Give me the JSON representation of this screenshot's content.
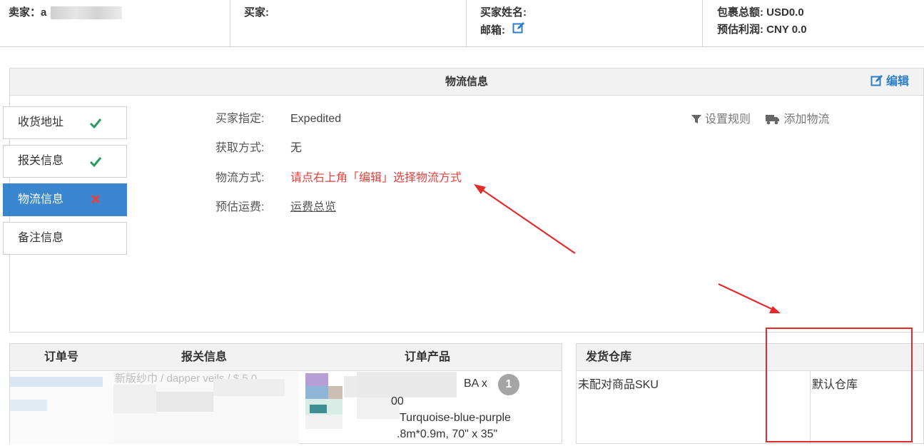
{
  "topbar": {
    "seller_label": "卖家：a",
    "buyer_label": "买家:",
    "buyer_name_label": "买家姓名:",
    "email_label": "邮箱:",
    "package_total": "包裹总额: USD0.0",
    "estimated_profit": "预估利润: CNY 0.0"
  },
  "logistics": {
    "title": "物流信息",
    "edit_label": "编辑",
    "tabs": [
      {
        "label": "收货地址",
        "status": "ok"
      },
      {
        "label": "报关信息",
        "status": "ok"
      },
      {
        "label": "物流信息",
        "status": "error"
      },
      {
        "label": "备注信息",
        "status": "none"
      }
    ],
    "rows": {
      "buyer_specified": {
        "label": "买家指定:",
        "value": "Expedited"
      },
      "acquire_method": {
        "label": "获取方式:",
        "value": "无"
      },
      "shipping_method": {
        "label": "物流方式:",
        "value": "请点右上角「编辑」选择物流方式"
      },
      "estimated_fee": {
        "label": "预估运费:",
        "value": "运费总览"
      }
    },
    "tools": {
      "set_rules": "设置规则",
      "add_logistics": "添加物流"
    }
  },
  "order_table": {
    "headers": {
      "order_no": "订单号",
      "customs": "报关信息",
      "product": "订单产品"
    },
    "customs_text": "新版纱巾 / dapper veils / $ 5.0",
    "product_line1": "BA x",
    "product_qty": "1",
    "product_line2": "00",
    "product_line3": "Turquoise-blue-purple",
    "product_line4": ".8m*0.9m, 70\" x 35\""
  },
  "warehouse_table": {
    "header": "发货仓库",
    "unmatched_sku": "未配对商品SKU",
    "default_warehouse": "默认仓库"
  },
  "colors": {
    "accent_blue": "#3a87d0",
    "link_blue": "#2d7ec7",
    "warning_red": "#e8413c",
    "check_green": "#2a9d5c",
    "annotation_red": "#e32b2b"
  }
}
